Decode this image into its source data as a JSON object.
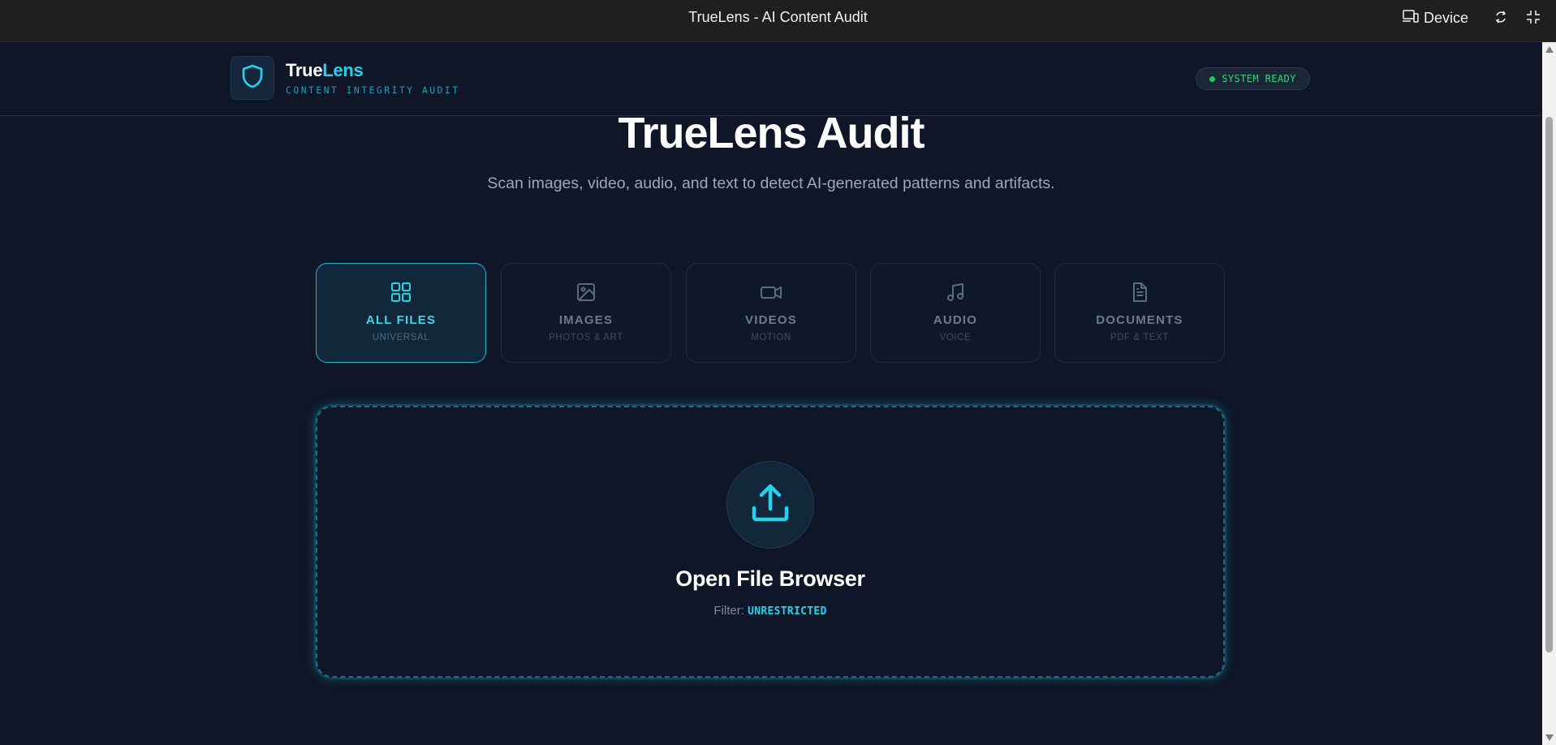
{
  "window": {
    "title": "TrueLens - AI Content Audit",
    "device_label": "Device"
  },
  "header": {
    "brand_part1": "True",
    "brand_part2": "Lens",
    "tagline": "CONTENT INTEGRITY AUDIT",
    "status": "SYSTEM READY",
    "status_color": "#22c55e"
  },
  "hero": {
    "title": "TrueLens Audit",
    "subtitle": "Scan images, video, audio, and text to detect AI-generated patterns and artifacts."
  },
  "categories": [
    {
      "label": "ALL FILES",
      "sub": "UNIVERSAL",
      "icon": "grid-icon",
      "active": true
    },
    {
      "label": "IMAGES",
      "sub": "PHOTOS & ART",
      "icon": "image-icon",
      "active": false
    },
    {
      "label": "VIDEOS",
      "sub": "MOTION",
      "icon": "video-icon",
      "active": false
    },
    {
      "label": "AUDIO",
      "sub": "VOICE",
      "icon": "music-note-icon",
      "active": false
    },
    {
      "label": "DOCUMENTS",
      "sub": "PDF & TEXT",
      "icon": "document-icon",
      "active": false
    }
  ],
  "dropzone": {
    "title": "Open File Browser",
    "filter_label": "Filter:",
    "filter_value": "UNRESTRICTED",
    "icon": "upload-icon"
  },
  "colors": {
    "accent": "#22d3ee",
    "background": "#0e1628"
  }
}
